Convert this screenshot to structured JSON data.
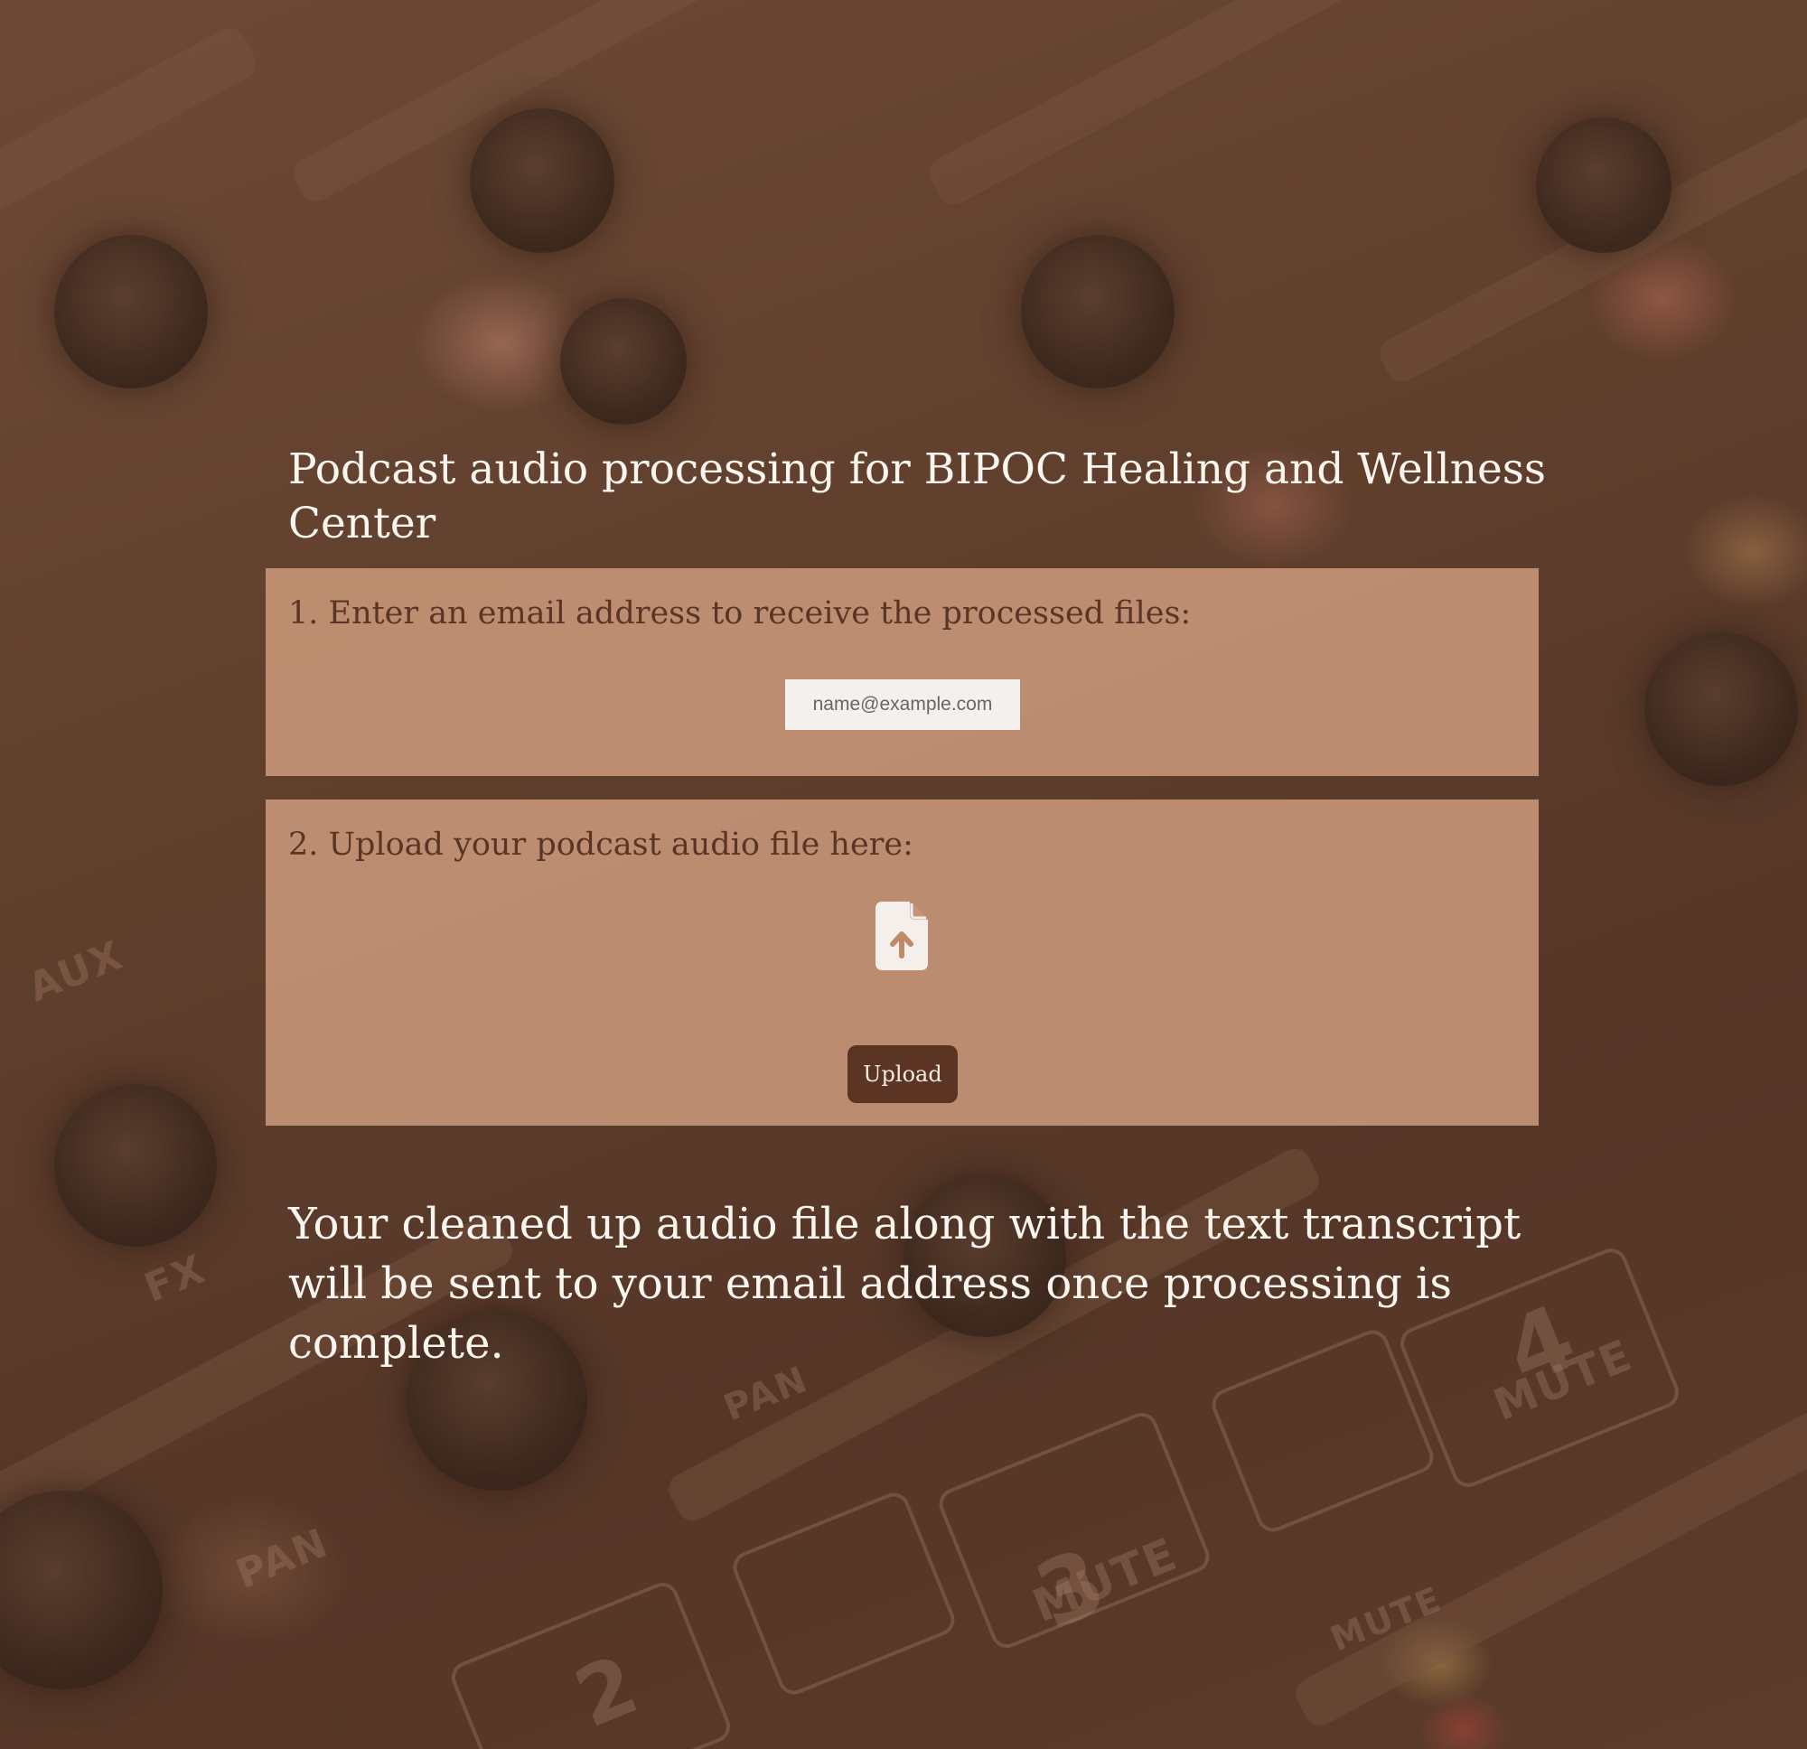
{
  "page": {
    "title": "Podcast audio processing for BIPOC Healing and Wellness Center",
    "notice": "Your cleaned up audio file along with the text transcript will be sent to your email address once processing is complete."
  },
  "email_section": {
    "label": "1. Enter an email address to receive the processed files:",
    "input_value": "",
    "input_placeholder": "name@example.com"
  },
  "upload_section": {
    "label": "2. Upload your podcast audio file here:",
    "icon": "file-upload-icon",
    "button_label": "Upload"
  },
  "colors": {
    "panel_bg": "#c49476",
    "panel_text": "#5a3424",
    "button_bg": "#5b3424",
    "button_text": "#f5ece4",
    "heading_text": "#fbf5ef",
    "input_bg": "#f4f0ed"
  }
}
